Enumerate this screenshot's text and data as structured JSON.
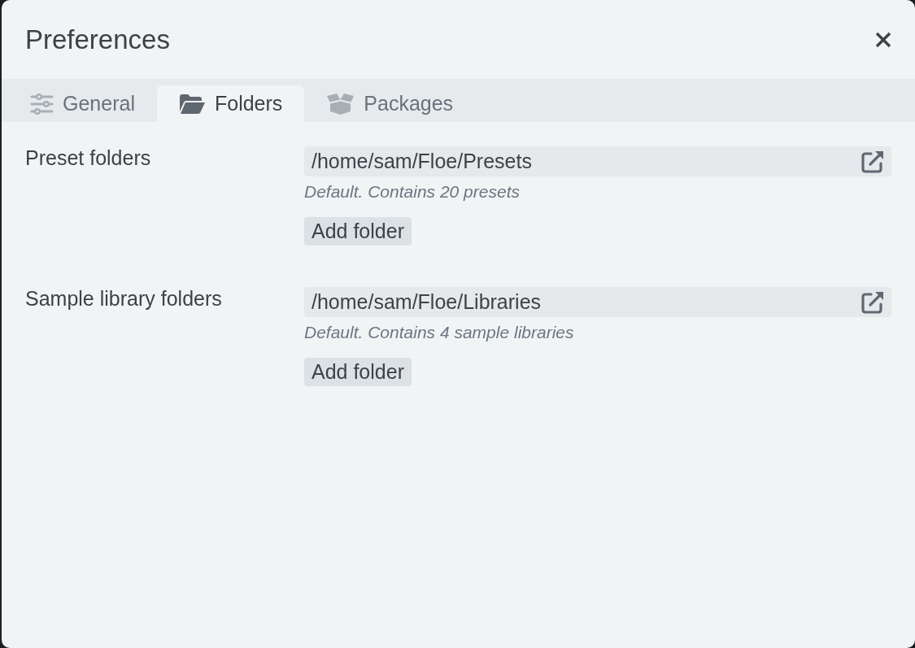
{
  "window": {
    "title": "Preferences"
  },
  "tabs": [
    {
      "label": "General",
      "selected": false
    },
    {
      "label": "Folders",
      "selected": true
    },
    {
      "label": "Packages",
      "selected": false
    }
  ],
  "sections": [
    {
      "label": "Preset folders",
      "folders": [
        {
          "path": "/home/sam/Floe/Presets",
          "note": "Default. Contains 20 presets"
        }
      ],
      "button": "Add folder"
    },
    {
      "label": "Sample library folders",
      "folders": [
        {
          "path": "/home/sam/Floe/Libraries",
          "note": "Default. Contains 4 sample libraries"
        }
      ],
      "button": "Add folder"
    }
  ]
}
